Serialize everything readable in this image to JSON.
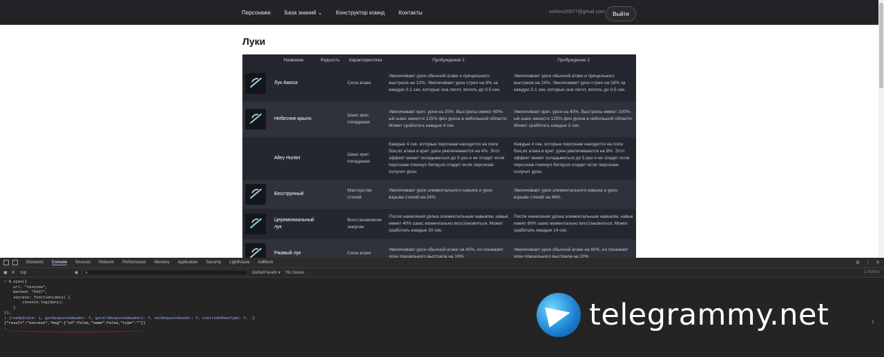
{
  "nav": {
    "items": [
      "Персонажи",
      "База знаний ⌄",
      "Конструктор комнд",
      "Контакты"
    ],
    "email": "snihino20077@gmail.com",
    "logout": "Выйти"
  },
  "page": {
    "title": "Луки"
  },
  "table": {
    "headers": [
      "Название",
      "Редкость",
      "Характеристика",
      "Пробуждение 1",
      "Пробуждение 2"
    ],
    "rows": [
      {
        "name": "Лук Амоса",
        "rarity": "",
        "stat": "Сила атаки",
        "a1": "Увеличивает урон обычной атаки и прицельного выстрела на 12%. Увеличивает урон стрел на 8% за каждую 0.1 сек. которые она летит, вплоть до 0.5 сек.",
        "a2": "Увеличивает урон обычной атаки и прицельного выстрела на 24%. Увеличивает урон стрел на 16% за каждую 0.1 сек. которые она летит, вплоть до 0.5 сек."
      },
      {
        "name": "Небесное крыло",
        "rarity": "",
        "stat": "Шанс крит. попадания",
        "a1": "Увеличивает крит. урон на 20%. Выстрелы имеют 60%-ый шанс нанести 125% физ урона в небольшой области. Может сработать каждые 4 сек.",
        "a2": "Увеличивает крит. урон на 40%. Выстрелы имеют 100%-ый шанс нанести 125% физ урона в небольшой области. Может сработать каждые 2 сек."
      },
      {
        "name": "Alley Hunter",
        "rarity": "",
        "stat": "Шанс крит. попадания",
        "a1": "Каждые 4 сек. которые персонаж находится на поле боя,их атака и крит. урон увеличиваются на 4%. Этот эффект может складываться до 5 раз и не спадет если персонаж покинул битву,но спадет если персонаж получит урон.",
        "a2": "Каждые 4 сек. которые персонаж находится на поле боя,их атака и крит. урон увеличиваются на 8%. Этот эффект может складываться до 5 раз и не спадет если персонаж покинул битву,но спадет если персонаж получит урон."
      },
      {
        "name": "Бесструнный",
        "rarity": "",
        "stat": "Мастерство стихий",
        "a1": "Увеличивает урон элементального навыка и урон взрыва стихий на 24%",
        "a2": "Увеличивает урон элементального навыка и урон взрыва стихий на 48%"
      },
      {
        "name": "Церемониальный лук",
        "rarity": "",
        "stat": "Восстановление энергии",
        "a1": "После нанесения урона элементальным навыком, навык имеет 40% шанс моментально восстановиться. Может сработать каждые 30 сек.",
        "a2": "После нанесения урона элементальным навыком, навык имеет 80% шанс моментально восстановиться. Может сработать каждые 14 сек."
      },
      {
        "name": "Ржавый лук",
        "rarity": "",
        "stat": "Сила атаки",
        "a1": "Увеличивает урон обычной атаки на 40%, но понижает урон прицельного выстрела на 10%",
        "a2": "Увеличивает урон обычной атаки на 80%, но понижает урон прицельного выстрела на 10%"
      }
    ]
  },
  "devtools": {
    "tabs": [
      "Elements",
      "Console",
      "Sources",
      "Network",
      "Performance",
      "Memory",
      "Application",
      "Security",
      "Lighthouse",
      "AdBlock"
    ],
    "active_tab": "Console",
    "context": "top",
    "filter_value": "a",
    "levels": "Default levels ▾",
    "issues": "No Issues",
    "hidden": "1 hidden",
    "code_lines": [
      "$.ajax({",
      "    url: \"testone\",",
      "    method: \"POST\",",
      "    success: function(data) {",
      "        console.log(data);",
      "    }",
      "});"
    ],
    "xhr_line": "{readyState: 1, getResponseHeader: f, getAllResponseHeaders: f, setRequestHeader: f, overrideMimeType: f, …}",
    "result_line": "{\"result\":\"success\",\"msg\":{\"id\":false,\"name\":false,\"type\":\"\"}}",
    "result_source": "3"
  },
  "watermark": {
    "text": "telegrammy.net"
  }
}
